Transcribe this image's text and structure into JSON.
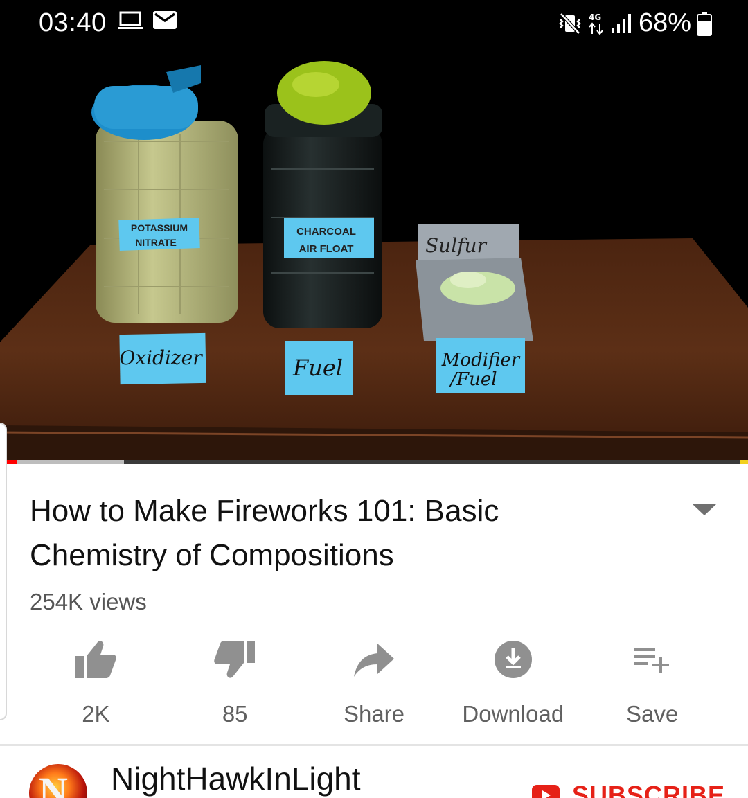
{
  "status_bar": {
    "time": "03:40",
    "battery": "68%",
    "network": "4G",
    "left_icons": [
      "laptop-icon",
      "mail-icon"
    ],
    "right_icons": [
      "mute-vibrate-icon",
      "data-arrows-icon",
      "signal-icon",
      "battery-icon"
    ]
  },
  "video": {
    "labels": {
      "jar1_line1": "POTASSIUM",
      "jar1_line2": "NITRATE",
      "jar2_line1": "CHARCOAL",
      "jar2_line2": "AIR FLOAT",
      "sulfur": "Sulfur",
      "card1": "Oxidizer",
      "card2": "Fuel",
      "card3_line1": "Modifier",
      "card3_line2": "/Fuel"
    },
    "progress": {
      "played_fraction": 0.022,
      "buffered_fraction": 0.166
    }
  },
  "info": {
    "title": "How to Make Fireworks 101: Basic Chemistry of Compositions",
    "views": "254K views"
  },
  "actions": [
    {
      "label": "2K",
      "icon": "thumbs-up-icon"
    },
    {
      "label": "85",
      "icon": "thumbs-down-icon"
    },
    {
      "label": "Share",
      "icon": "share-icon"
    },
    {
      "label": "Download",
      "icon": "download-icon"
    },
    {
      "label": "Save",
      "icon": "playlist-add-icon"
    }
  ],
  "channel": {
    "name": "NightHawkInLight",
    "avatar_letter": "N",
    "subscribe_label": "SUBSCRIBE"
  },
  "colors": {
    "accent": "#ff0000",
    "subscribe": "#e62117",
    "text": "#111111",
    "secondary": "#606060"
  }
}
